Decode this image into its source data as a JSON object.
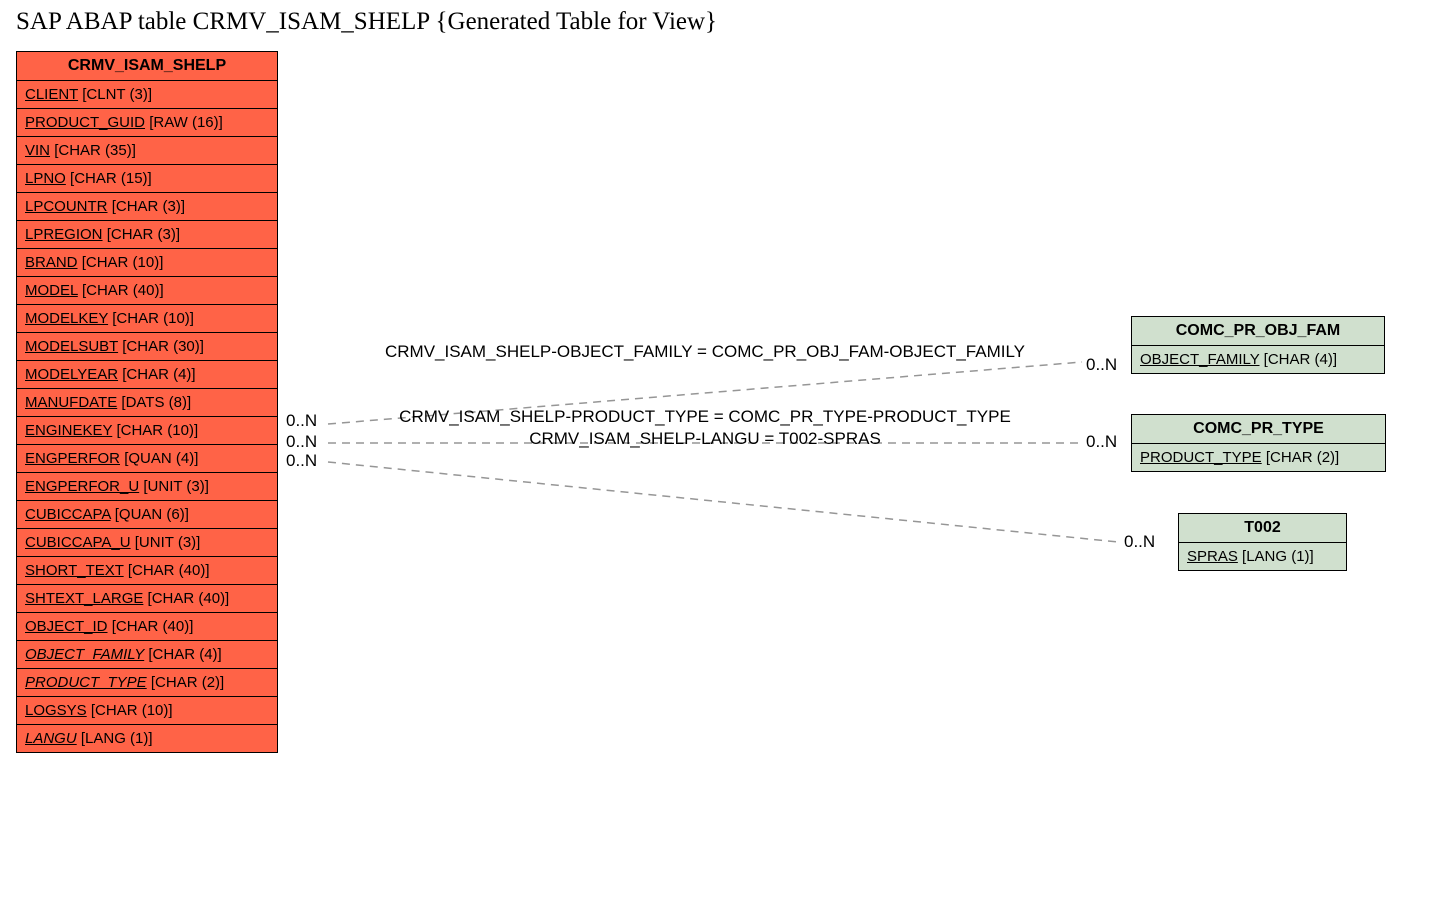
{
  "title": "SAP ABAP table CRMV_ISAM_SHELP {Generated Table for View}",
  "mainEntity": {
    "name": "CRMV_ISAM_SHELP",
    "fields": [
      {
        "name": "CLIENT",
        "type": "[CLNT (3)]",
        "italic": false
      },
      {
        "name": "PRODUCT_GUID",
        "type": "[RAW (16)]",
        "italic": false
      },
      {
        "name": "VIN",
        "type": "[CHAR (35)]",
        "italic": false
      },
      {
        "name": "LPNO",
        "type": "[CHAR (15)]",
        "italic": false
      },
      {
        "name": "LPCOUNTR",
        "type": "[CHAR (3)]",
        "italic": false
      },
      {
        "name": "LPREGION",
        "type": "[CHAR (3)]",
        "italic": false
      },
      {
        "name": "BRAND",
        "type": "[CHAR (10)]",
        "italic": false
      },
      {
        "name": "MODEL",
        "type": "[CHAR (40)]",
        "italic": false
      },
      {
        "name": "MODELKEY",
        "type": "[CHAR (10)]",
        "italic": false
      },
      {
        "name": "MODELSUBT",
        "type": "[CHAR (30)]",
        "italic": false
      },
      {
        "name": "MODELYEAR",
        "type": "[CHAR (4)]",
        "italic": false
      },
      {
        "name": "MANUFDATE",
        "type": "[DATS (8)]",
        "italic": false
      },
      {
        "name": "ENGINEKEY",
        "type": "[CHAR (10)]",
        "italic": false
      },
      {
        "name": "ENGPERFOR",
        "type": "[QUAN (4)]",
        "italic": false
      },
      {
        "name": "ENGPERFOR_U",
        "type": "[UNIT (3)]",
        "italic": false
      },
      {
        "name": "CUBICCAPA",
        "type": "[QUAN (6)]",
        "italic": false
      },
      {
        "name": "CUBICCAPA_U",
        "type": "[UNIT (3)]",
        "italic": false
      },
      {
        "name": "SHORT_TEXT",
        "type": "[CHAR (40)]",
        "italic": false
      },
      {
        "name": "SHTEXT_LARGE",
        "type": "[CHAR (40)]",
        "italic": false
      },
      {
        "name": "OBJECT_ID",
        "type": "[CHAR (40)]",
        "italic": false
      },
      {
        "name": "OBJECT_FAMILY",
        "type": "[CHAR (4)]",
        "italic": true
      },
      {
        "name": "PRODUCT_TYPE",
        "type": "[CHAR (2)]",
        "italic": true
      },
      {
        "name": "LOGSYS",
        "type": "[CHAR (10)]",
        "italic": false
      },
      {
        "name": "LANGU",
        "type": "[LANG (1)]",
        "italic": true
      }
    ]
  },
  "relEntities": [
    {
      "id": "ent1",
      "name": "COMC_PR_OBJ_FAM",
      "fields": [
        {
          "name": "OBJECT_FAMILY",
          "type": "[CHAR (4)]",
          "italic": false
        }
      ]
    },
    {
      "id": "ent2",
      "name": "COMC_PR_TYPE",
      "fields": [
        {
          "name": "PRODUCT_TYPE",
          "type": "[CHAR (2)]",
          "italic": false
        }
      ]
    },
    {
      "id": "ent3",
      "name": "T002",
      "fields": [
        {
          "name": "SPRAS",
          "type": "[LANG (1)]",
          "italic": false
        }
      ]
    }
  ],
  "cardinalities": {
    "left1": "0..N",
    "left2": "0..N",
    "left3": "0..N",
    "right1": "0..N",
    "right2": "0..N",
    "right3": "0..N"
  },
  "relLabels": {
    "r1": "CRMV_ISAM_SHELP-OBJECT_FAMILY = COMC_PR_OBJ_FAM-OBJECT_FAMILY",
    "r2": "CRMV_ISAM_SHELP-PRODUCT_TYPE = COMC_PR_TYPE-PRODUCT_TYPE",
    "r3": "CRMV_ISAM_SHELP-LANGU = T002-SPRAS"
  },
  "chart_data": {
    "type": "er-diagram",
    "entities": [
      {
        "name": "CRMV_ISAM_SHELP",
        "role": "main",
        "fields": [
          "CLIENT CLNT(3)",
          "PRODUCT_GUID RAW(16)",
          "VIN CHAR(35)",
          "LPNO CHAR(15)",
          "LPCOUNTR CHAR(3)",
          "LPREGION CHAR(3)",
          "BRAND CHAR(10)",
          "MODEL CHAR(40)",
          "MODELKEY CHAR(10)",
          "MODELSUBT CHAR(30)",
          "MODELYEAR CHAR(4)",
          "MANUFDATE DATS(8)",
          "ENGINEKEY CHAR(10)",
          "ENGPERFOR QUAN(4)",
          "ENGPERFOR_U UNIT(3)",
          "CUBICCAPA QUAN(6)",
          "CUBICCAPA_U UNIT(3)",
          "SHORT_TEXT CHAR(40)",
          "SHTEXT_LARGE CHAR(40)",
          "OBJECT_ID CHAR(40)",
          "OBJECT_FAMILY CHAR(4)",
          "PRODUCT_TYPE CHAR(2)",
          "LOGSYS CHAR(10)",
          "LANGU LANG(1)"
        ]
      },
      {
        "name": "COMC_PR_OBJ_FAM",
        "fields": [
          "OBJECT_FAMILY CHAR(4)"
        ]
      },
      {
        "name": "COMC_PR_TYPE",
        "fields": [
          "PRODUCT_TYPE CHAR(2)"
        ]
      },
      {
        "name": "T002",
        "fields": [
          "SPRAS LANG(1)"
        ]
      }
    ],
    "relationships": [
      {
        "from": "CRMV_ISAM_SHELP.OBJECT_FAMILY",
        "to": "COMC_PR_OBJ_FAM.OBJECT_FAMILY",
        "cardinality_from": "0..N",
        "cardinality_to": "0..N"
      },
      {
        "from": "CRMV_ISAM_SHELP.PRODUCT_TYPE",
        "to": "COMC_PR_TYPE.PRODUCT_TYPE",
        "cardinality_from": "0..N",
        "cardinality_to": "0..N"
      },
      {
        "from": "CRMV_ISAM_SHELP.LANGU",
        "to": "T002.SPRAS",
        "cardinality_from": "0..N",
        "cardinality_to": "0..N"
      }
    ]
  }
}
